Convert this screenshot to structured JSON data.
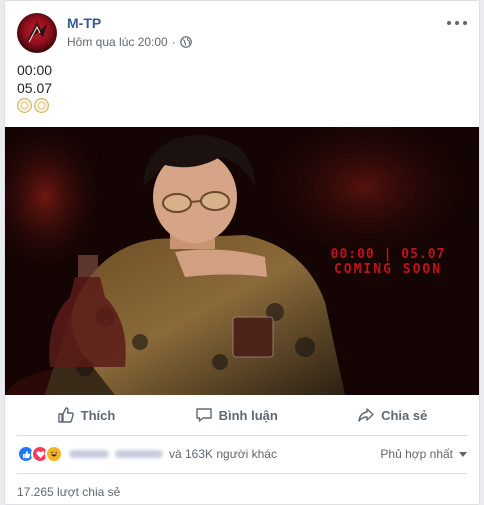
{
  "post": {
    "author": "M-TP",
    "timestamp": "Hôm qua lúc 20:00",
    "separator": "·",
    "privacy_icon": "globe-icon",
    "text_lines": [
      "00:00",
      "05.07"
    ],
    "emoji": "disc-icon"
  },
  "image": {
    "overlay_time": "00:00 | 05.07",
    "overlay_subtitle": "COMING SOON"
  },
  "actions": {
    "like_label": "Thích",
    "comment_label": "Bình luận",
    "share_label": "Chia sẻ"
  },
  "reactions": {
    "types": [
      "like",
      "love",
      "haha"
    ],
    "others_text": "và 163K người khác",
    "sort_label": "Phủ hợp nhất"
  },
  "shares_text": "17.265 lượt chia sẻ",
  "colors": {
    "brand_link": "#385898",
    "overlay_red": "#c0121c",
    "like_blue": "#2078f4",
    "love_red": "#f33e58",
    "haha_yellow": "#f7b125"
  }
}
